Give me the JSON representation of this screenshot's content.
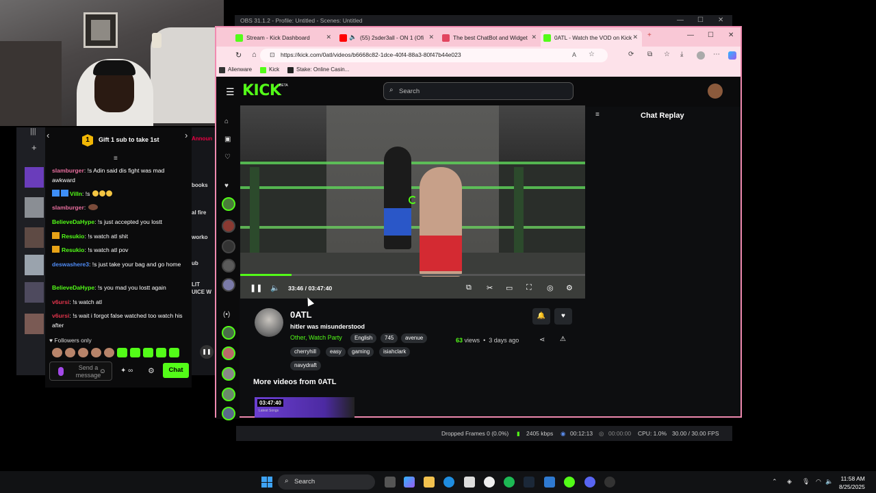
{
  "chat_overlay": {
    "gift_label": "Gift 1 sub to take 1st",
    "gift_count": "1",
    "messages": [
      {
        "user": "slamburger",
        "text": ": !s Adin said dis fight was mad awkward",
        "color": "#e86e9e"
      },
      {
        "user": "Villn",
        "text": ": !s",
        "color": "#53fc18"
      },
      {
        "user": "slamburger",
        "text": ":",
        "color": "#e86e9e"
      },
      {
        "user": "BelieveDaHype",
        "text": ": !s just accepted you lostt",
        "color": "#53fc18"
      },
      {
        "user": "Resukio",
        "text": ": !s watch atl shit",
        "color": "#53fc18"
      },
      {
        "user": "Resukio",
        "text": ": !s watch atl pov",
        "color": "#53fc18"
      },
      {
        "user": "deswashere3",
        "text": ": !s just take your bag and go home",
        "color": "#4f8cf7"
      },
      {
        "user": "BelieveDaHype",
        "text": ": !s you mad you lostt again",
        "color": "#53fc18"
      },
      {
        "user": "v6ursi",
        "text": ": !s watch atl",
        "color": "#e0344b"
      },
      {
        "user": "v6ursi",
        "text": ": !s wait i forgot false watched too watch his after",
        "color": "#e0344b"
      }
    ],
    "followers_only": "Followers only",
    "send_placeholder": "Send a message",
    "chat_button": "Chat"
  },
  "obs": {
    "title": "OBS 31.1.2 - Profile: Untitled - Scenes: Untitled",
    "mid_labels": [
      "Announ",
      "books",
      "al fire",
      "worko",
      "ub",
      "LIT\nUICE W"
    ],
    "status": {
      "dropped": "Dropped Frames 0 (0.0%)",
      "bitrate": "2405 kbps",
      "rec_time": "00:12:13",
      "stream_time": "00:00:00",
      "cpu": "CPU: 1.0%",
      "fps": "30.00 / 30.00 FPS"
    }
  },
  "browser": {
    "tabs": [
      {
        "label": "Stream - Kick Dashboard",
        "color": "#53fc18"
      },
      {
        "label": "(55) 2sder3all - ON 1 (Ofi",
        "color": "#ff0000"
      },
      {
        "label": "The best ChatBot and Widget",
        "color": "#e2455f"
      },
      {
        "label": "0ATL - Watch the VOD on Kick",
        "color": "#53fc18"
      }
    ],
    "url": "https://kick.com/0atl/videos/b6668c82-1dce-40f4-88a3-80f47b44e023",
    "bookmarks": [
      "Alienware",
      "Kick",
      "Stake: Online Casin..."
    ]
  },
  "kick": {
    "logo": "KICK",
    "logo_beta": "BETA",
    "search_placeholder": "Search",
    "chat_replay_title": "Chat Replay",
    "video": {
      "time": "33:46 / 03:47:40",
      "progress": 0.148
    },
    "channel": {
      "name": "0ATL",
      "title": "hitler was misunderstood",
      "category": "Other, Watch Party",
      "tags": [
        "English",
        "745",
        "avenue",
        "cherryhill",
        "easy",
        "gaming",
        "isiahclark",
        "navydraft"
      ],
      "views_count": "63",
      "views_label": "views",
      "separator": "•",
      "age": "3 days ago"
    },
    "more_videos_heading": "More videos from 0ATL",
    "thumb": {
      "duration": "03:47:40",
      "caption": "Latest Songs"
    }
  },
  "taskbar": {
    "search_label": "Search",
    "time": "11:58 AM",
    "date": "8/25/2025"
  }
}
